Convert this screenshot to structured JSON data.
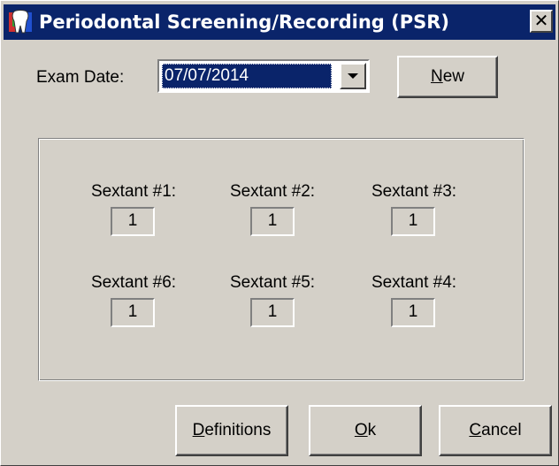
{
  "window": {
    "title": "Periodontal Screening/Recording (PSR)",
    "close_glyph": "✕",
    "icon": "tooth-icon"
  },
  "exam": {
    "label": "Exam Date:",
    "value": "07/07/2014",
    "new_button": {
      "prefix": "",
      "mnemonic": "N",
      "suffix": "ew"
    }
  },
  "sextants": [
    {
      "label": "Sextant #1:",
      "value": "1"
    },
    {
      "label": "Sextant #2:",
      "value": "1"
    },
    {
      "label": "Sextant #3:",
      "value": "1"
    },
    {
      "label": "Sextant #6:",
      "value": "1"
    },
    {
      "label": "Sextant #5:",
      "value": "1"
    },
    {
      "label": "Sextant #4:",
      "value": "1"
    }
  ],
  "buttons": {
    "definitions": {
      "mnemonic": "D",
      "suffix": "efinitions"
    },
    "ok": {
      "mnemonic": "O",
      "suffix": "k"
    },
    "cancel": {
      "mnemonic": "C",
      "suffix": "ancel"
    }
  },
  "colors": {
    "titlebar": "#0a246a",
    "face": "#d4d0c8",
    "selection": "#0a246a"
  }
}
